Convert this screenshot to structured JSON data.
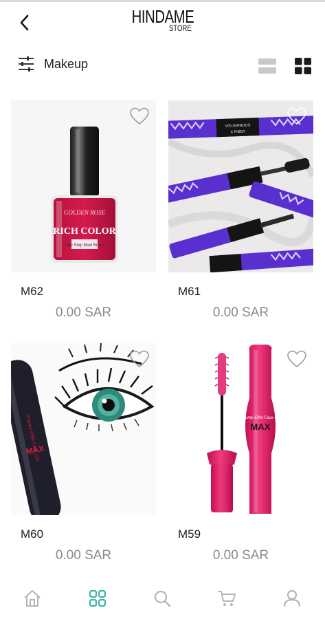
{
  "app": {
    "logo_main": "HINDAME",
    "logo_sub": "STORE"
  },
  "filter": {
    "category_label": "Makeup",
    "view_mode": "grid"
  },
  "products": [
    {
      "name": "M62",
      "price": "0.00 SAR",
      "favorite": false,
      "image": "nail-polish"
    },
    {
      "name": "M61",
      "price": "0.00 SAR",
      "favorite": false,
      "image": "mascara-set"
    },
    {
      "name": "M60",
      "price": "0.00 SAR",
      "favorite": false,
      "image": "eye-mascara"
    },
    {
      "name": "M59",
      "price": "0.00 SAR",
      "favorite": false,
      "image": "pink-mascara"
    }
  ],
  "product_image_text": {
    "nail_brand": "GOLDEN ROSE",
    "nail_title": "RICH COLOR",
    "nail_sub": "One Step Maxi Brush",
    "eye_brand": "Volume Effet Faux Cils",
    "eye_title": "MAX",
    "mascara_brand": "Volume Effet Faux Cils",
    "mascara_title": "MAX",
    "tube_label": "VOLUMINOUS",
    "tube_label2": "X FIBER"
  },
  "bottom_nav": {
    "items": [
      "home-icon",
      "categories-icon",
      "search-icon",
      "cart-icon",
      "profile-icon"
    ],
    "active": "categories-icon"
  },
  "colors": {
    "accent": "#3cb3ad",
    "nav_inactive": "#b5b5b5",
    "price": "#8a8a8a"
  }
}
